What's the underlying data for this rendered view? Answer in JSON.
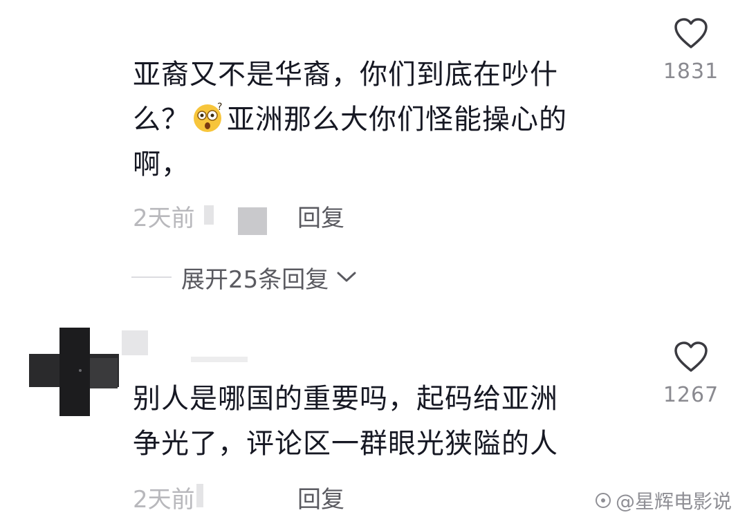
{
  "comments": [
    {
      "text_line1": "亚裔又不是华裔，你们到底在吵什",
      "text_line2_pre": "么？",
      "emoji": "shocked-face-emoji",
      "text_line2_post": "亚洲那么大你们怪能操心的",
      "text_line3": "啊，",
      "time": "2天前",
      "reply_label": "回复",
      "likes": "1831",
      "expand_label": "展开25条回复"
    },
    {
      "text_line1": "别人是哪国的重要吗，起码给亚洲",
      "text_line2": "争光了，评论区一群眼光狭隘的人",
      "time": "2天前",
      "reply_label": "回复",
      "likes": "1267"
    }
  ],
  "watermark": "@星辉电影说",
  "icons": {
    "like": "heart-outline-icon",
    "expand": "chevron-down-icon",
    "watermark": "brand-logo-icon"
  },
  "colors": {
    "text": "#161823",
    "meta": "#b8b8bc",
    "secondary": "#5a5a60",
    "like_count": "#8a8a90"
  }
}
